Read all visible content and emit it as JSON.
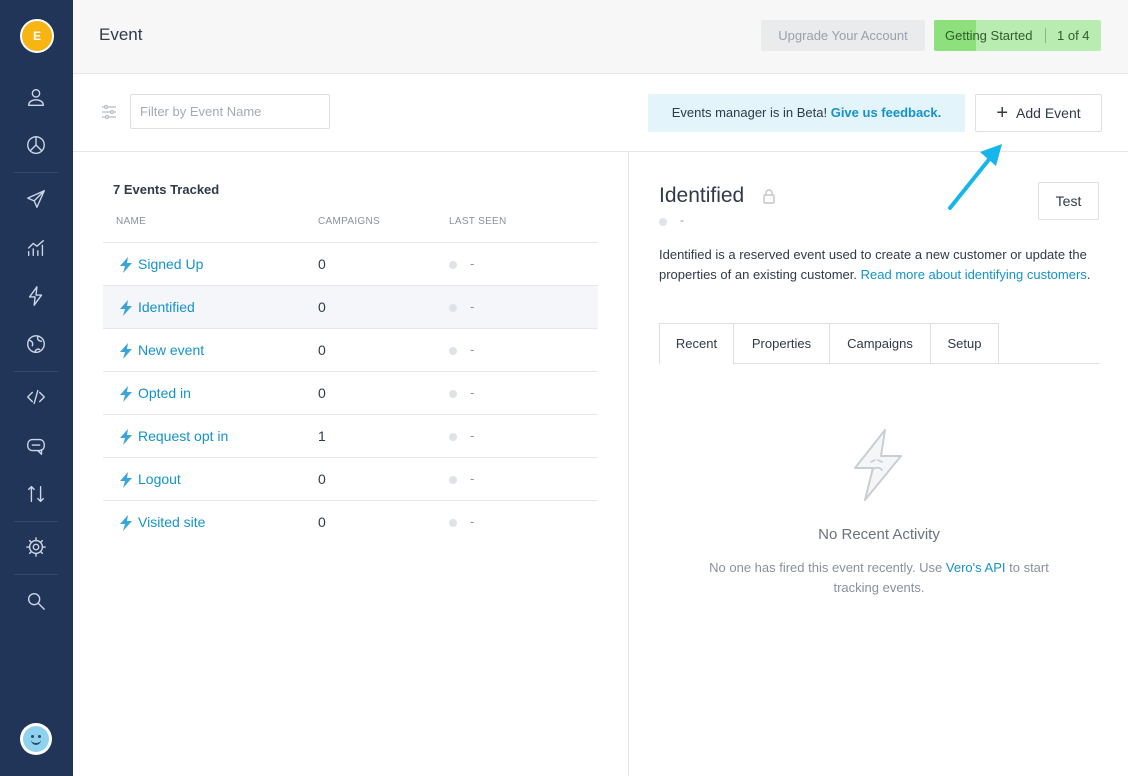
{
  "sidebar": {
    "avatar_initial": "E",
    "icons": [
      "user-icon",
      "pie-chart-icon",
      "send-icon",
      "analytics-icon",
      "lightning-icon",
      "globe-icon",
      "code-icon",
      "chat-icon",
      "transfer-icon",
      "gear-icon",
      "search-icon",
      "smiley-avatar"
    ]
  },
  "header": {
    "title": "Event",
    "upgrade_label": "Upgrade Your Account",
    "getting_started_label": "Getting Started",
    "getting_started_count": "1 of 4",
    "getting_started_progress": 0.25
  },
  "toolbar": {
    "filter_placeholder": "Filter by Event Name",
    "filter_value": "",
    "beta_text": "Events manager is in Beta!",
    "beta_link": "Give us feedback.",
    "add_event_label": "Add Event"
  },
  "list": {
    "count_label": "7 Events Tracked",
    "columns": [
      "NAME",
      "CAMPAIGNS",
      "LAST SEEN"
    ],
    "rows": [
      {
        "name": "Signed Up",
        "campaigns": "0",
        "last_seen": "-"
      },
      {
        "name": "Identified",
        "campaigns": "0",
        "last_seen": "-"
      },
      {
        "name": "New event",
        "campaigns": "0",
        "last_seen": "-"
      },
      {
        "name": "Opted in",
        "campaigns": "0",
        "last_seen": "-"
      },
      {
        "name": "Request opt in",
        "campaigns": "1",
        "last_seen": "-"
      },
      {
        "name": "Logout",
        "campaigns": "0",
        "last_seen": "-"
      },
      {
        "name": "Visited site",
        "campaigns": "0",
        "last_seen": "-"
      }
    ]
  },
  "detail": {
    "title": "Identified",
    "last_seen": "-",
    "test_label": "Test",
    "desc_text": "Identified is a reserved event used to create a new customer or update the properties of an existing customer.",
    "desc_link": "Read more about identifying customers",
    "desc_end": ".",
    "tabs": [
      "Recent",
      "Properties",
      "Campaigns",
      "Setup"
    ],
    "empty_title": "No Recent Activity",
    "empty_text_before": "No one has fired this event recently. Use",
    "empty_link": "Vero's API",
    "empty_text_after": "to start tracking events."
  },
  "colors": {
    "sidebar": "#213559",
    "link": "#1593c9",
    "progress_fill": "#8ee07c",
    "progress_bg": "#b9ecb0",
    "arrow": "#16b6ec"
  }
}
